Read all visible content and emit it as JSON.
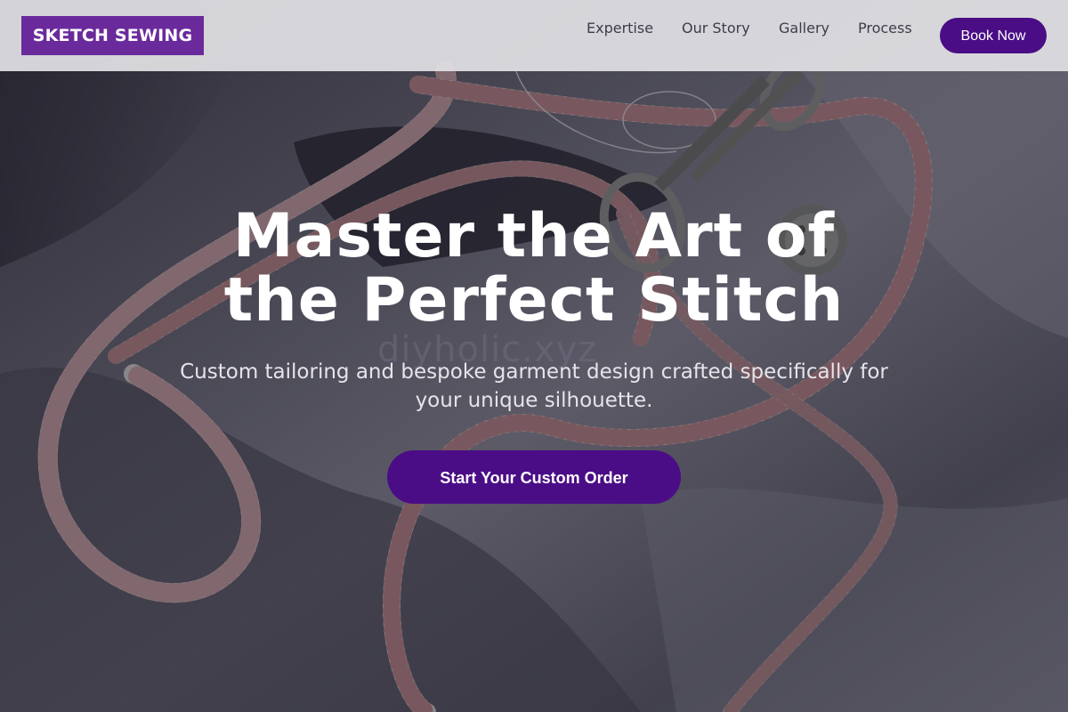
{
  "brand": {
    "logo_text": "SKETCH SEWING"
  },
  "nav": {
    "links": [
      "Expertise",
      "Our Story",
      "Gallery",
      "Process"
    ],
    "book_label": "Book Now"
  },
  "hero": {
    "title_line1": "Master the Art of",
    "title_line2": "the Perfect Stitch",
    "subtitle_line1": "Custom tailoring and bespoke garment design crafted specifically for",
    "subtitle_line2": "your unique silhouette.",
    "cta_label": "Start Your Custom Order",
    "watermark_text": "diyholic.xyz"
  },
  "colors": {
    "accent": "#4a0d86",
    "logo_bg": "#6a2a9c",
    "navbar_bg": "#e1e1e4"
  }
}
